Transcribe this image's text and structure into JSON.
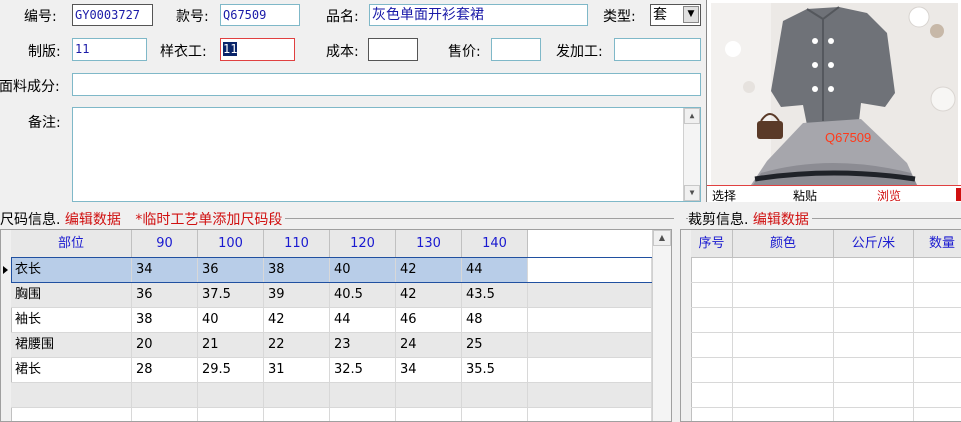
{
  "form": {
    "code": {
      "label": "编号:",
      "value": "GY0003727"
    },
    "style_no": {
      "label": "款号:",
      "value": "Q67509"
    },
    "product_name": {
      "label": "品名:",
      "value": "灰色单面开衫套裙"
    },
    "type": {
      "label": "类型:",
      "value": "套"
    },
    "pattern_maker": {
      "label": "制版:",
      "value": "11"
    },
    "sample_worker": {
      "label": "样衣工:",
      "value": "11"
    },
    "cost": {
      "label": "成本:",
      "value": ""
    },
    "price": {
      "label": "售价:",
      "value": ""
    },
    "outsource": {
      "label": "发加工:",
      "value": ""
    },
    "fabric": {
      "label": "面料成分:",
      "value": ""
    },
    "remarks": {
      "label": "备注:",
      "value": ""
    }
  },
  "photo": {
    "code_overlay": "Q67509",
    "actions": [
      "选择",
      "粘贴",
      "浏览"
    ]
  },
  "size_section": {
    "title": "尺码信息.",
    "edit_link": "编辑数据",
    "add_link": "*临时工艺单添加尺码段",
    "columns": [
      "部位",
      "90",
      "100",
      "110",
      "120",
      "130",
      "140"
    ],
    "rows": [
      [
        "衣长",
        "34",
        "36",
        "38",
        "40",
        "42",
        "44"
      ],
      [
        "胸围",
        "36",
        "37.5",
        "39",
        "40.5",
        "42",
        "43.5"
      ],
      [
        "袖长",
        "38",
        "40",
        "42",
        "44",
        "46",
        "48"
      ],
      [
        "裙腰围",
        "20",
        "21",
        "22",
        "23",
        "24",
        "25"
      ],
      [
        "裙长",
        "28",
        "29.5",
        "31",
        "32.5",
        "34",
        "35.5"
      ]
    ],
    "selected_row": 0
  },
  "cut_section": {
    "title": "裁剪信息.",
    "edit_link": "编辑数据",
    "columns": [
      "序号",
      "颜色",
      "公斤/米",
      "数量"
    ]
  },
  "colors": {
    "accent_red": "#d01010",
    "header_blue": "#1a1ad0",
    "selected_row": "#b8cde8"
  }
}
